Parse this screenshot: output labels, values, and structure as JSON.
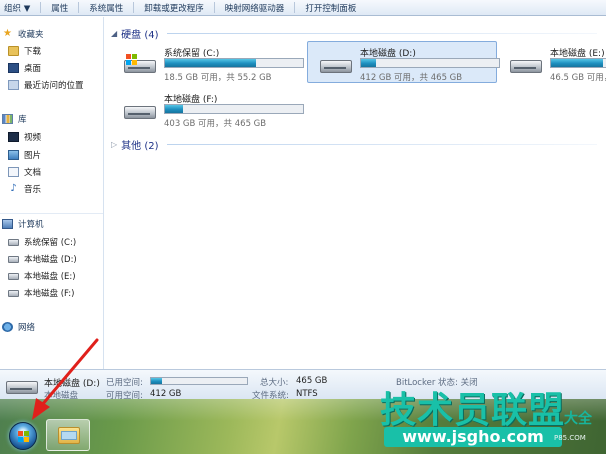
{
  "toolbar": {
    "items": [
      "组织 ▼",
      "属性",
      "系统属性",
      "卸载或更改程序",
      "映射网络驱动器",
      "打开控制面板"
    ]
  },
  "nav": {
    "favorites": {
      "label": "收藏夹",
      "items": [
        "下载",
        "桌面",
        "最近访问的位置"
      ]
    },
    "libraries": {
      "label": "库",
      "items": [
        "视频",
        "图片",
        "文档",
        "音乐"
      ]
    },
    "computer": {
      "label": "计算机",
      "items": [
        "系统保留 (C:)",
        "本地磁盘 (D:)",
        "本地磁盘 (E:)",
        "本地磁盘 (F:)"
      ]
    },
    "network": {
      "label": "网络"
    }
  },
  "main": {
    "hdd_group": {
      "label": "硬盘 (4)"
    },
    "other_group": {
      "label": "其他 (2)"
    },
    "drives": [
      {
        "name": "系统保留 (C:)",
        "info": "18.5 GB 可用，共 55.2 GB",
        "used_fraction": 0.66,
        "selected": false
      },
      {
        "name": "本地磁盘 (D:)",
        "info": "412 GB 可用，共 465 GB",
        "used_fraction": 0.11,
        "selected": true
      },
      {
        "name": "本地磁盘 (E:)",
        "info": "46.5 GB 可用，共 ...",
        "used_fraction": 0.9,
        "selected": false
      },
      {
        "name": "本地磁盘 (F:)",
        "info": "403 GB 可用，共 465 GB",
        "used_fraction": 0.13,
        "selected": false
      }
    ]
  },
  "details": {
    "name": "本地磁盘 (D:)",
    "type": "本地磁盘",
    "used_label": "已用空间:",
    "free_label": "可用空间:",
    "free_value": "412 GB",
    "used_fraction": 0.11,
    "total_label": "总大小:",
    "total_value": "465 GB",
    "fs_label": "文件系统:",
    "fs_value": "NTFS",
    "bitlocker": "BitLocker 状态: 关闭"
  },
  "watermark": {
    "big": "技术员联盟",
    "small": "大全",
    "url": "www.jsgho.com",
    "tiny": "P85.COM"
  },
  "colors": {
    "accent": "#1d8fbf",
    "selection": "#dbe9f9",
    "watermark": "#19c0a8"
  }
}
